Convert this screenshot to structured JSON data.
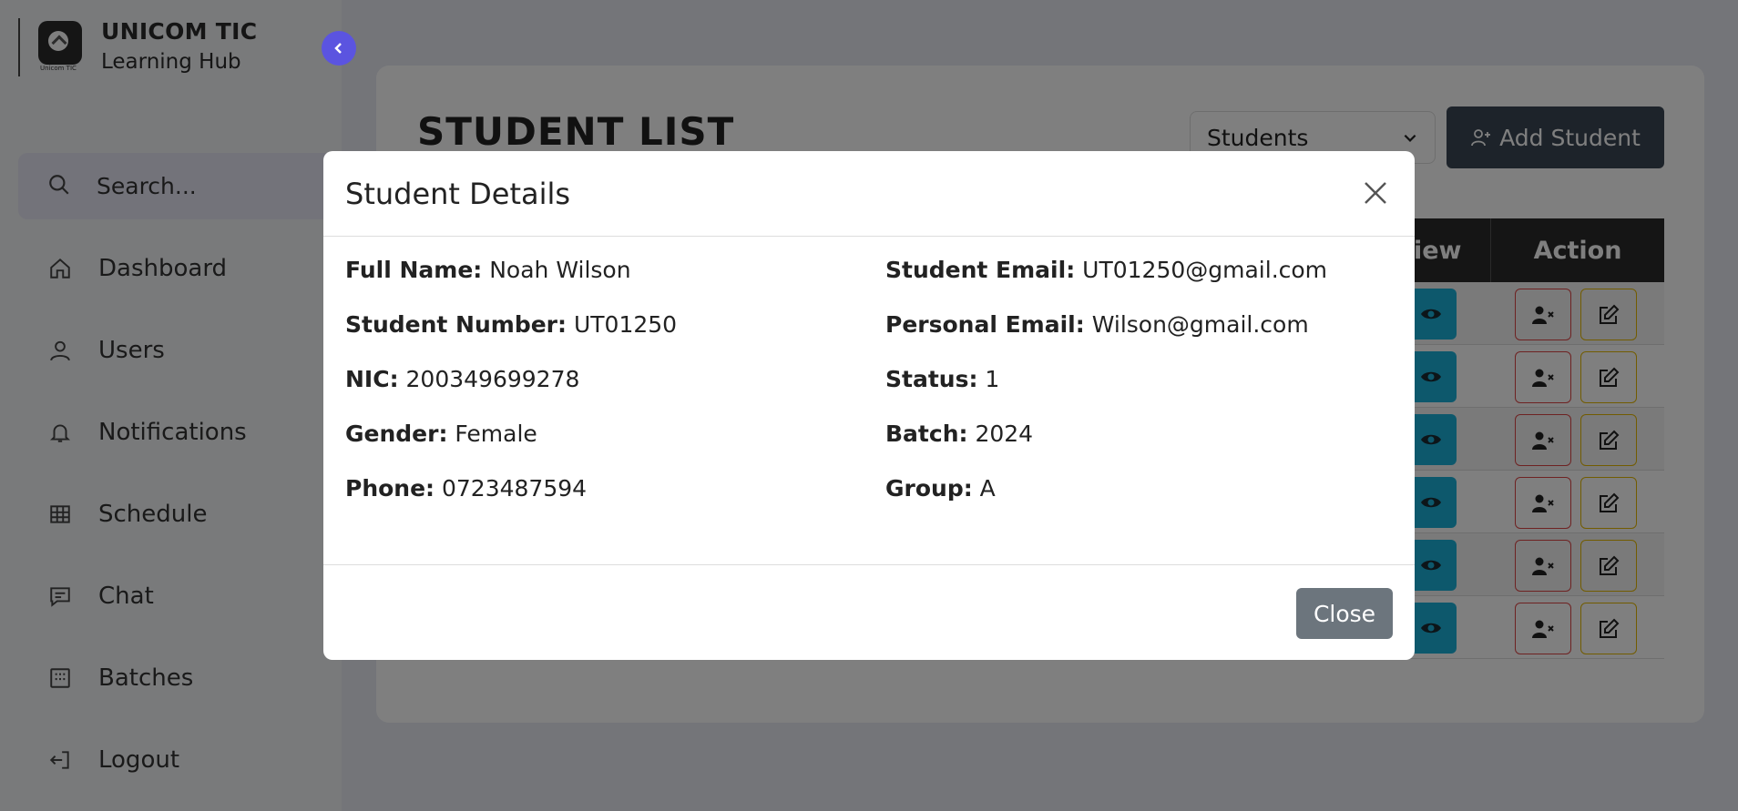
{
  "brand": {
    "title": "UNICOM TIC",
    "subtitle": "Learning Hub",
    "logo_caption": "Unicom TIC"
  },
  "sidebar": {
    "search_placeholder": "Search...",
    "items": [
      {
        "label": "Dashboard",
        "icon": "home-icon"
      },
      {
        "label": "Users",
        "icon": "user-icon"
      },
      {
        "label": "Notifications",
        "icon": "bell-icon"
      },
      {
        "label": "Schedule",
        "icon": "table-icon"
      },
      {
        "label": "Chat",
        "icon": "chat-icon"
      },
      {
        "label": "Batches",
        "icon": "batches-icon"
      },
      {
        "label": "Logout",
        "icon": "logout-icon"
      }
    ]
  },
  "main": {
    "title": "STUDENT LIST",
    "filter_value": "Students",
    "add_button": "Add Student",
    "table": {
      "headers": {
        "view": "View",
        "action": "Action"
      },
      "row_count": 6
    }
  },
  "modal": {
    "title": "Student Details",
    "close_button": "Close",
    "left": [
      {
        "label": "Full Name:",
        "value": "Noah Wilson"
      },
      {
        "label": "Student Number:",
        "value": "UT01250"
      },
      {
        "label": "NIC:",
        "value": "200349699278"
      },
      {
        "label": "Gender:",
        "value": "Female"
      },
      {
        "label": "Phone:",
        "value": "0723487594"
      }
    ],
    "right": [
      {
        "label": "Student Email:",
        "value": "UT01250@gmail.com"
      },
      {
        "label": "Personal Email:",
        "value": "Wilson@gmail.com"
      },
      {
        "label": "Status:",
        "value": "1"
      },
      {
        "label": "Batch:",
        "value": "2024"
      },
      {
        "label": "Group:",
        "value": "A"
      }
    ]
  },
  "colors": {
    "accent": "#5b54e0",
    "view": "#1ab0d8",
    "dark": "#2b2b2b"
  }
}
